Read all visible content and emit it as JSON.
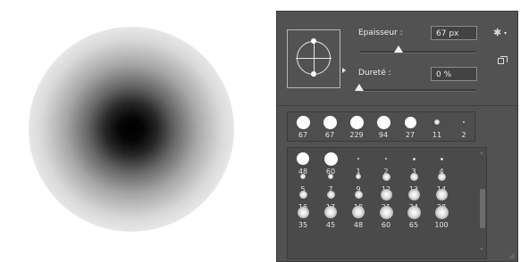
{
  "brush_settings": {
    "size_label": "Epaisseur :",
    "size_value": "67 px",
    "size_slider_fraction": 0.34,
    "hardness_label": "Dureté :",
    "hardness_value": "0 %",
    "hardness_slider_fraction": 0.0,
    "gear_icon": "gear-icon",
    "new_preset_icon": "new-preset-icon"
  },
  "recent_brushes": [
    "67",
    "67",
    "229",
    "94",
    "27",
    "11",
    "2"
  ],
  "brush_presets": [
    "48",
    "60",
    "1",
    "2",
    "3",
    "4",
    "5",
    "7",
    "9",
    "12",
    "13",
    "14",
    "16",
    "17",
    "18",
    "21",
    "24",
    "28",
    "35",
    "45",
    "48",
    "60",
    "65",
    "100"
  ],
  "colors": {
    "panel_bg": "#525252",
    "input_bg": "#434343",
    "text": "#ececec"
  }
}
